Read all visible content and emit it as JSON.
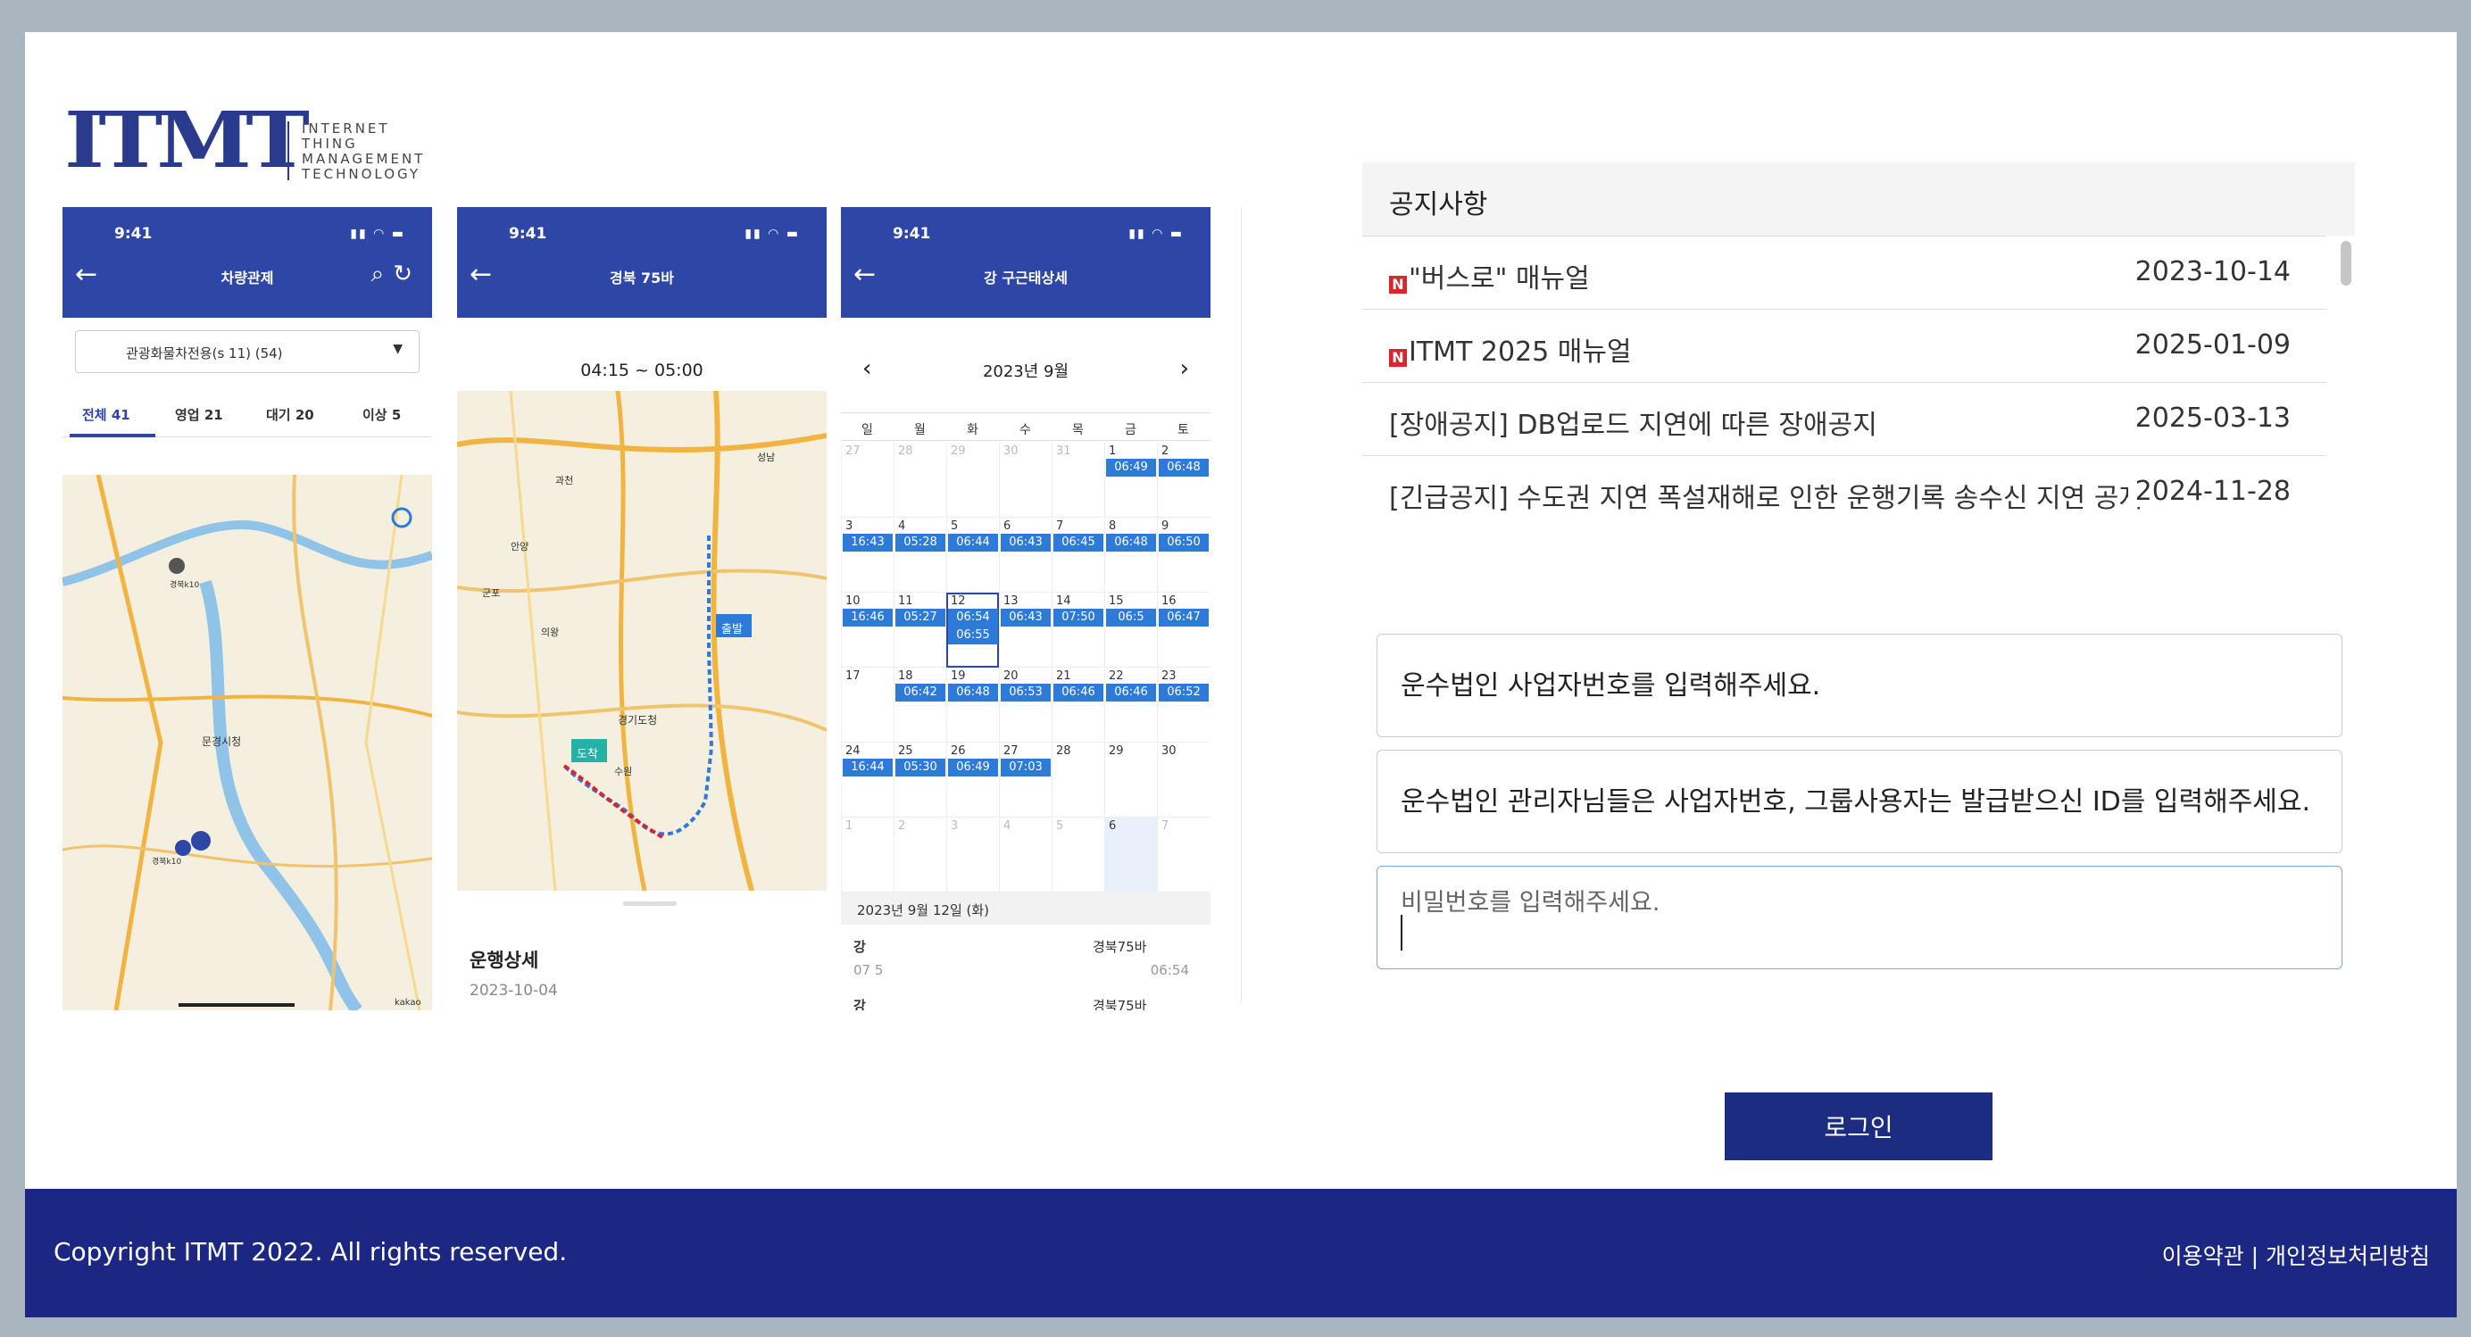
{
  "logo": {
    "mark": "ITMT",
    "words": [
      "INTERNET",
      "THING",
      "MANAGEMENT",
      "TECHNOLOGY"
    ]
  },
  "colors": {
    "brand": "#2e46a6",
    "footer": "#1b2783",
    "button": "#1c2c80",
    "event": "#2e7ad8",
    "badge": "#d8262c"
  },
  "phone1": {
    "time": "9:41",
    "title": "차량관제",
    "select": "관광화물차전용(s 11) (54)",
    "tabs": [
      {
        "label": "전체 41"
      },
      {
        "label": "영업 21"
      },
      {
        "label": "대기 20"
      },
      {
        "label": "이상 5"
      }
    ],
    "map_labels": [
      "경북k10",
      "문경시청",
      "경북k10",
      "kakao"
    ]
  },
  "phone2": {
    "time": "9:41",
    "title": "경북 75바",
    "range": "04:15 ~ 05:00",
    "map_labels": [
      "출발",
      "도착",
      "경기도청",
      "과천",
      "안양",
      "군포",
      "의왕",
      "수원",
      "성남"
    ],
    "detail_title": "운행상세",
    "detail_date": "2023-10-04"
  },
  "phone3": {
    "time": "9:41",
    "title": "강 구근태상세",
    "month": "2023년 9월",
    "dow": [
      "일",
      "월",
      "화",
      "수",
      "목",
      "금",
      "토"
    ],
    "weeks": [
      [
        {
          "n": "27",
          "dim": true
        },
        {
          "n": "28",
          "dim": true
        },
        {
          "n": "29",
          "dim": true
        },
        {
          "n": "30",
          "dim": true
        },
        {
          "n": "31",
          "dim": true
        },
        {
          "n": "1",
          "ev": [
            "06:49"
          ]
        },
        {
          "n": "2",
          "ev": [
            "06:48"
          ]
        }
      ],
      [
        {
          "n": "3",
          "ev": [
            "16:43"
          ]
        },
        {
          "n": "4",
          "ev": [
            "05:28"
          ]
        },
        {
          "n": "5",
          "ev": [
            "06:44"
          ]
        },
        {
          "n": "6",
          "ev": [
            "06:43"
          ]
        },
        {
          "n": "7",
          "ev": [
            "06:45"
          ]
        },
        {
          "n": "8",
          "ev": [
            "06:48"
          ]
        },
        {
          "n": "9",
          "ev": [
            "06:50"
          ]
        }
      ],
      [
        {
          "n": "10",
          "ev": [
            "16:46"
          ]
        },
        {
          "n": "11",
          "ev": [
            "05:27"
          ]
        },
        {
          "n": "12",
          "ev": [
            "06:54",
            "06:55"
          ],
          "today": true
        },
        {
          "n": "13",
          "ev": [
            "06:43"
          ]
        },
        {
          "n": "14",
          "ev": [
            "07:50"
          ]
        },
        {
          "n": "15",
          "ev": [
            "06:5"
          ]
        },
        {
          "n": "16",
          "ev": [
            "06:47"
          ]
        }
      ],
      [
        {
          "n": "17"
        },
        {
          "n": "18",
          "ev": [
            "06:42"
          ]
        },
        {
          "n": "19",
          "ev": [
            "06:48"
          ]
        },
        {
          "n": "20",
          "ev": [
            "06:53"
          ]
        },
        {
          "n": "21",
          "ev": [
            "06:46"
          ]
        },
        {
          "n": "22",
          "ev": [
            "06:46"
          ]
        },
        {
          "n": "23",
          "ev": [
            "06:52"
          ]
        }
      ],
      [
        {
          "n": "24",
          "ev": [
            "16:44"
          ]
        },
        {
          "n": "25",
          "ev": [
            "05:30"
          ]
        },
        {
          "n": "26",
          "ev": [
            "06:49"
          ]
        },
        {
          "n": "27",
          "ev": [
            "07:03"
          ]
        },
        {
          "n": "28"
        },
        {
          "n": "29"
        },
        {
          "n": "30"
        }
      ],
      [
        {
          "n": "1",
          "dim": true
        },
        {
          "n": "2",
          "dim": true
        },
        {
          "n": "3",
          "dim": true
        },
        {
          "n": "4",
          "dim": true
        },
        {
          "n": "5",
          "dim": true
        },
        {
          "n": "6",
          "shade": true
        },
        {
          "n": "7",
          "dim": true
        }
      ]
    ],
    "summary_date": "2023년 9월 12일 (화)",
    "rows": [
      {
        "name": "강",
        "plate": "경북75바",
        "sub": "07 5",
        "time": "06:54"
      },
      {
        "name": "강",
        "plate": "경북75바",
        "sub": "",
        "time": ""
      }
    ]
  },
  "notices": {
    "title": "공지사항",
    "items": [
      {
        "new": true,
        "badge": "N",
        "text": "\"버스로\" 매뉴얼",
        "date": "2023-10-14"
      },
      {
        "new": true,
        "badge": "N",
        "text": "ITMT 2025 매뉴얼",
        "date": "2025-01-09"
      },
      {
        "new": false,
        "text": "[장애공지] DB업로드 지연에 따른 장애공지",
        "date": "2025-03-13"
      },
      {
        "new": false,
        "text": "[긴급공지] 수도권 지연 폭설재해로 인한 운행기록 송수신 지연 공지",
        "date": "2024-11-28"
      }
    ]
  },
  "login": {
    "business_placeholder": "운수법인 사업자번호를 입력해주세요.",
    "id_placeholder": "운수법인 관리자님들은 사업자번호, 그룹사용자는 발급받으신 ID를 입력해주세요.",
    "password_placeholder": "비밀번호를 입력해주세요.",
    "button": "로그인"
  },
  "footer": {
    "copyright": "Copyright ITMT 2022. All rights reserved.",
    "terms": "이용약관",
    "separator": "|",
    "privacy": "개인정보처리방침"
  }
}
